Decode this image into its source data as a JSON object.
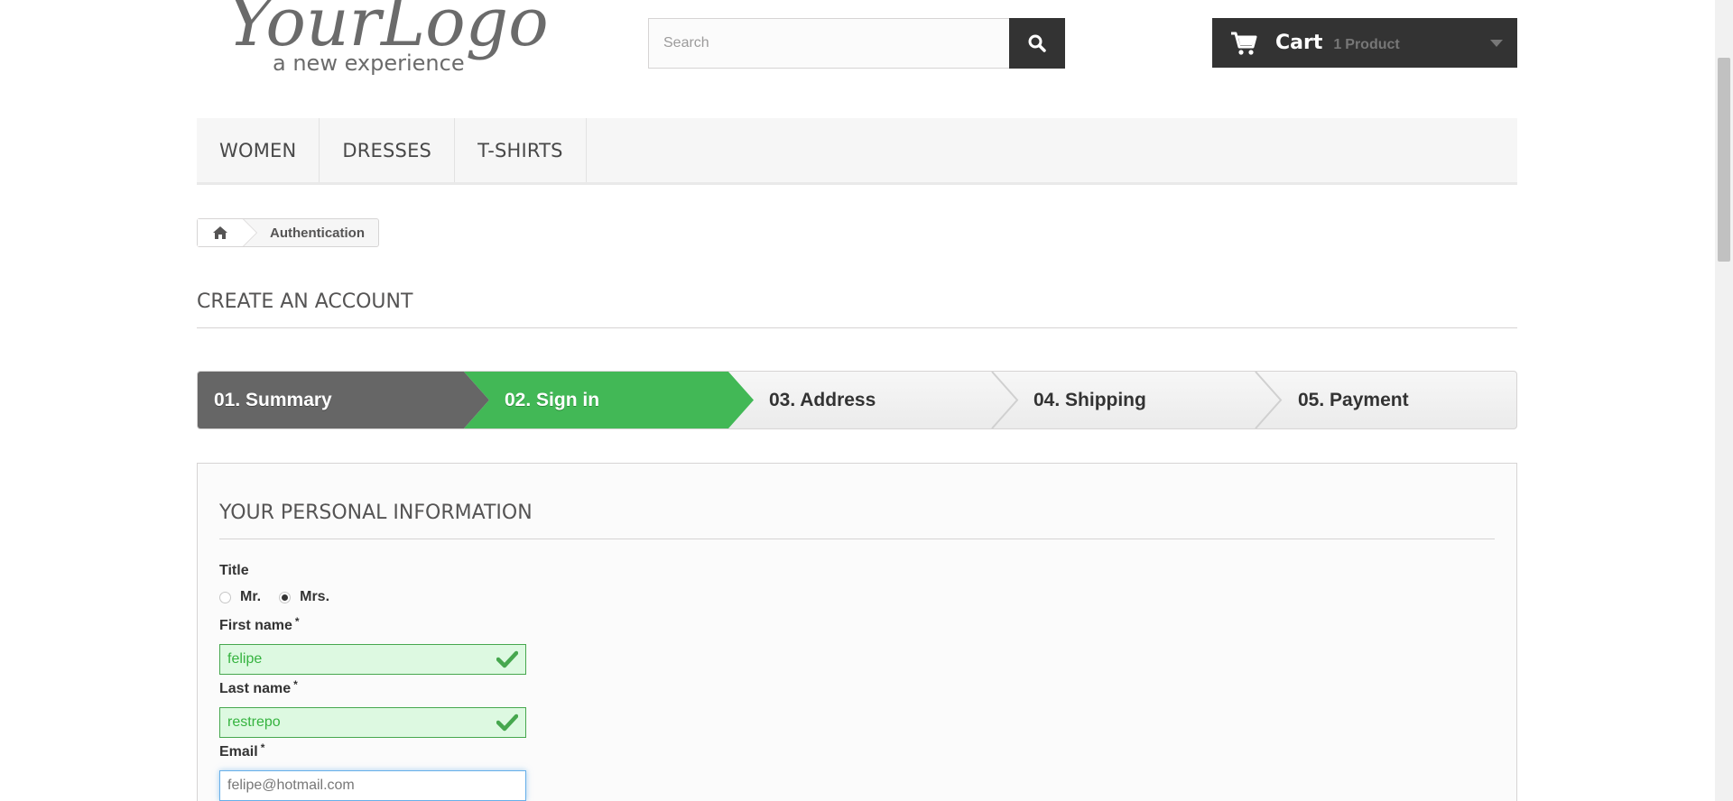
{
  "header": {
    "logo_main": "YourLogo",
    "logo_tagline": "a new experience",
    "search": {
      "placeholder": "Search",
      "icon": "search-icon"
    },
    "cart": {
      "label": "Cart",
      "count": "1",
      "count_word": "Product",
      "icon": "cart-icon"
    }
  },
  "menu": {
    "items": [
      {
        "label": "WOMEN"
      },
      {
        "label": "DRESSES"
      },
      {
        "label": "T-SHIRTS"
      }
    ]
  },
  "breadcrumb": {
    "home_icon": "home-icon",
    "current": "Authentication"
  },
  "page": {
    "heading": "CREATE AN ACCOUNT"
  },
  "steps": [
    {
      "label": "01. Summary",
      "state": "done"
    },
    {
      "label": "02. Sign in",
      "state": "current"
    },
    {
      "label": "03. Address",
      "state": "todo"
    },
    {
      "label": "04. Shipping",
      "state": "todo"
    },
    {
      "label": "05. Payment",
      "state": "todo"
    }
  ],
  "form": {
    "section_heading": "YOUR PERSONAL INFORMATION",
    "title_label": "Title",
    "title_options": [
      {
        "label": "Mr.",
        "checked": false
      },
      {
        "label": "Mrs.",
        "checked": true
      }
    ],
    "first_name_label": "First name",
    "first_name_value": "felipe",
    "last_name_label": "Last name",
    "last_name_value": "restrepo",
    "email_label": "Email",
    "email_value": "felipe@hotmail.com",
    "required_mark": "*"
  },
  "colors": {
    "dark": "#333333",
    "step_done": "#666666",
    "step_current": "#42b856",
    "valid_green": "#46a74e",
    "valid_bg": "#ddf9e1"
  }
}
